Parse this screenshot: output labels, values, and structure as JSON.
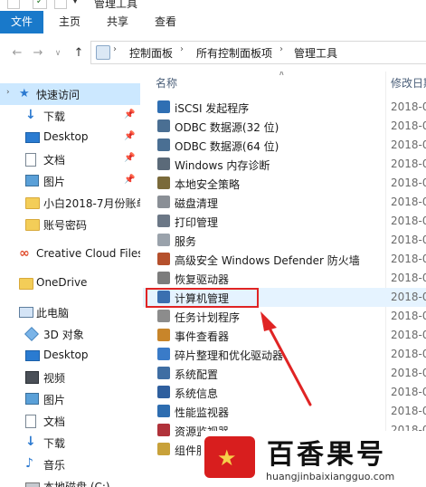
{
  "window": {
    "title": "管理工具"
  },
  "ribbon": {
    "tabs": [
      "文件",
      "主页",
      "共享",
      "查看"
    ]
  },
  "address": {
    "crumbs": [
      "控制面板",
      "所有控制面板项",
      "管理工具"
    ]
  },
  "nav_pane": {
    "items": [
      {
        "label": "快速访问",
        "icon": "star-icon"
      },
      {
        "label": "下载",
        "icon": "download-icon",
        "pinned": true
      },
      {
        "label": "Desktop",
        "icon": "desktop-icon",
        "pinned": true
      },
      {
        "label": "文档",
        "icon": "document-icon",
        "pinned": true
      },
      {
        "label": "图片",
        "icon": "pictures-icon",
        "pinned": true
      },
      {
        "label": "小白2018-7月份账单",
        "icon": "folder-icon"
      },
      {
        "label": "账号密码",
        "icon": "folder-icon"
      },
      {
        "label": "Creative Cloud Files",
        "icon": "creative-cloud-icon"
      },
      {
        "label": "OneDrive",
        "icon": "folder-icon"
      },
      {
        "label": "此电脑",
        "icon": "computer-icon"
      },
      {
        "label": "3D 对象",
        "icon": "3d-objects-icon"
      },
      {
        "label": "Desktop",
        "icon": "desktop-icon"
      },
      {
        "label": "视频",
        "icon": "video-icon"
      },
      {
        "label": "图片",
        "icon": "pictures-icon"
      },
      {
        "label": "文档",
        "icon": "document-icon"
      },
      {
        "label": "下载",
        "icon": "download-icon"
      },
      {
        "label": "音乐",
        "icon": "music-icon"
      },
      {
        "label": "本地磁盘 (C:)",
        "icon": "drive-icon"
      }
    ]
  },
  "content": {
    "columns": {
      "name": "名称",
      "date": "修改日期"
    },
    "rows": [
      {
        "name": "iSCSI 发起程序",
        "date": "2018-0",
        "icon_color": "#2f6fb3"
      },
      {
        "name": "ODBC 数据源(32 位)",
        "date": "2018-0",
        "icon_color": "#4a6f93"
      },
      {
        "name": "ODBC 数据源(64 位)",
        "date": "2018-0",
        "icon_color": "#4a6f93"
      },
      {
        "name": "Windows 内存诊断",
        "date": "2018-0",
        "icon_color": "#5b6a79"
      },
      {
        "name": "本地安全策略",
        "date": "2018-0",
        "icon_color": "#7a6a3a"
      },
      {
        "name": "磁盘清理",
        "date": "2018-0",
        "icon_color": "#8a8f96"
      },
      {
        "name": "打印管理",
        "date": "2018-0",
        "icon_color": "#6b7786"
      },
      {
        "name": "服务",
        "date": "2018-0",
        "icon_color": "#9aa2ab"
      },
      {
        "name": "高级安全 Windows Defender 防火墙",
        "date": "2018-0",
        "icon_color": "#b5502c"
      },
      {
        "name": "恢复驱动器",
        "date": "2018-0",
        "icon_color": "#7c7c7c"
      },
      {
        "name": "计算机管理",
        "date": "2018-0",
        "icon_color": "#3b6fb0",
        "selected": true
      },
      {
        "name": "任务计划程序",
        "date": "2018-0",
        "icon_color": "#8c8c8c"
      },
      {
        "name": "事件查看器",
        "date": "2018-0",
        "icon_color": "#c8852a"
      },
      {
        "name": "碎片整理和优化驱动器",
        "date": "2018-0",
        "icon_color": "#3a7bc8"
      },
      {
        "name": "系统配置",
        "date": "2018-0",
        "icon_color": "#3f6ea3"
      },
      {
        "name": "系统信息",
        "date": "2018-0",
        "icon_color": "#2f5f9e"
      },
      {
        "name": "性能监视器",
        "date": "2018-0",
        "icon_color": "#2e6db0"
      },
      {
        "name": "资源监视器",
        "date": "2018-0",
        "icon_color": "#b0323a"
      },
      {
        "name": "组件服务",
        "date": "2018-0",
        "icon_color": "#c8a13a"
      }
    ]
  },
  "watermark": {
    "brand": "百香果号",
    "url": "huangjinbaixiangguo.com"
  },
  "colors": {
    "accent": "#1979ca",
    "selection": "#cce8ff",
    "annotation": "#e02424"
  }
}
